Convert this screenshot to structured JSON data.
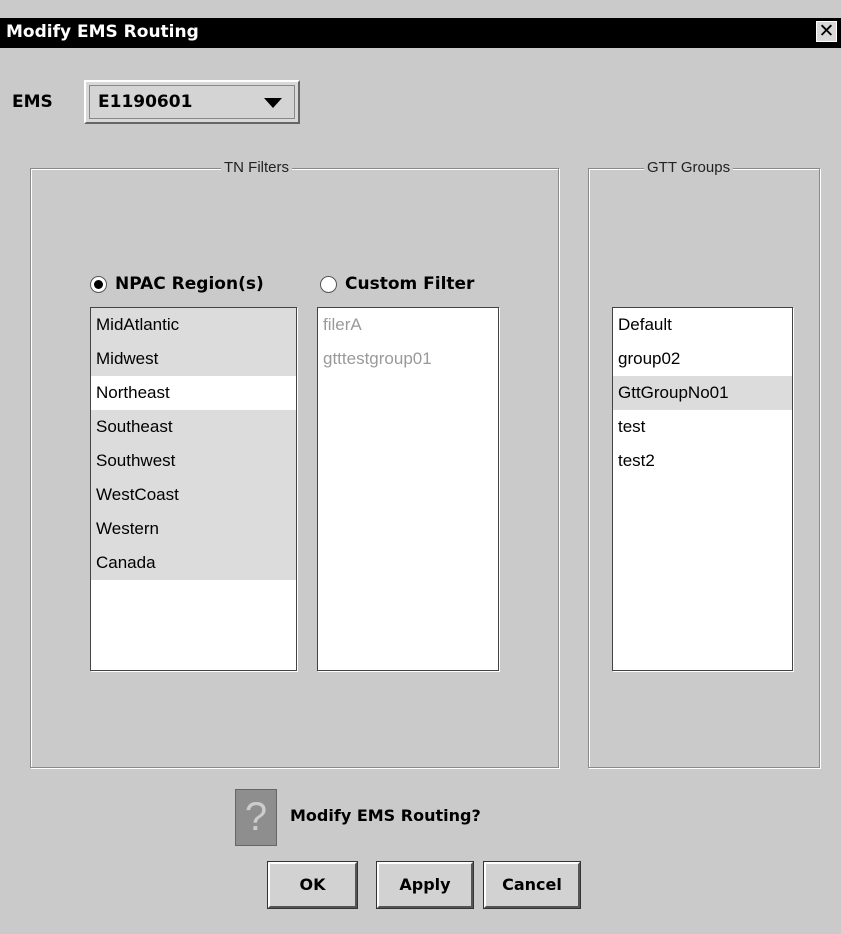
{
  "window": {
    "title": "Modify EMS Routing",
    "close_glyph": "✕"
  },
  "ems": {
    "label": "EMS",
    "selected": "E1190601"
  },
  "tn_filters": {
    "title": "TN Filters",
    "npac_label": "NPAC Region(s)",
    "custom_label": "Custom Filter",
    "npac_selected": true,
    "regions": [
      {
        "label": "MidAtlantic",
        "selected": true
      },
      {
        "label": "Midwest",
        "selected": true
      },
      {
        "label": "Northeast",
        "selected": false
      },
      {
        "label": "Southeast",
        "selected": true
      },
      {
        "label": "Southwest",
        "selected": true
      },
      {
        "label": "WestCoast",
        "selected": true
      },
      {
        "label": "Western",
        "selected": true
      },
      {
        "label": "Canada",
        "selected": true
      }
    ],
    "custom_filters": [
      "filerA",
      "gtttestgroup01"
    ]
  },
  "gtt_groups": {
    "title": "GTT Groups",
    "items": [
      {
        "label": "Default",
        "selected": false
      },
      {
        "label": "group02",
        "selected": false
      },
      {
        "label": "GttGroupNo01",
        "selected": true
      },
      {
        "label": "test",
        "selected": false
      },
      {
        "label": "test2",
        "selected": false
      }
    ]
  },
  "footer": {
    "question_glyph": "?",
    "prompt": "Modify EMS Routing?",
    "ok_label": "OK",
    "apply_label": "Apply",
    "cancel_label": "Cancel"
  }
}
